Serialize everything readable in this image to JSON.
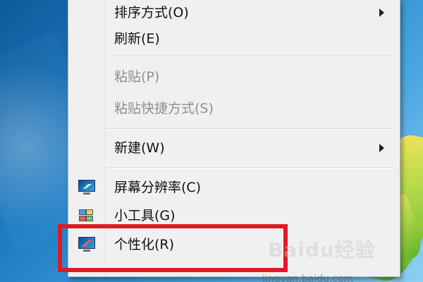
{
  "desktop": {
    "watermark_text": "Baidu经验",
    "watermark_url": "jingyan.baidu.com"
  },
  "context_menu": {
    "items": [
      {
        "label": "排序方式(O)",
        "has_submenu": true,
        "disabled": false
      },
      {
        "label": "刷新(E)",
        "has_submenu": false,
        "disabled": false
      },
      {
        "label": "粘贴(P)",
        "has_submenu": false,
        "disabled": true
      },
      {
        "label": "粘贴快捷方式(S)",
        "has_submenu": false,
        "disabled": true
      },
      {
        "label": "新建(W)",
        "has_submenu": true,
        "disabled": false
      },
      {
        "label": "屏幕分辨率(C)",
        "icon": "screen-resolution-icon",
        "has_submenu": false,
        "disabled": false
      },
      {
        "label": "小工具(G)",
        "icon": "gadgets-icon",
        "has_submenu": false,
        "disabled": false
      },
      {
        "label": "个性化(R)",
        "icon": "personalize-icon",
        "has_submenu": false,
        "disabled": false
      }
    ]
  },
  "annotation": {
    "highlight_color": "#e01923",
    "highlighted_item": "个性化(R)"
  }
}
